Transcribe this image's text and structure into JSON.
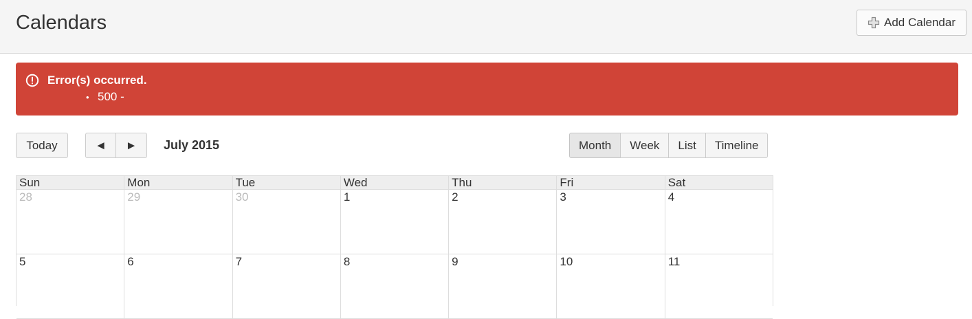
{
  "header": {
    "title": "Calendars",
    "add_button_label": "Add Calendar"
  },
  "alert": {
    "title": "Error(s) occurred.",
    "bullet": "•",
    "items": [
      "500 -"
    ]
  },
  "toolbar": {
    "today_label": "Today",
    "prev_label": "◄",
    "next_label": "►",
    "period_title": "July 2015",
    "views": [
      {
        "label": "Month",
        "active": true
      },
      {
        "label": "Week",
        "active": false
      },
      {
        "label": "List",
        "active": false
      },
      {
        "label": "Timeline",
        "active": false
      }
    ]
  },
  "calendar": {
    "day_names": [
      "Sun",
      "Mon",
      "Tue",
      "Wed",
      "Thu",
      "Fri",
      "Sat"
    ],
    "weeks": [
      [
        {
          "day": "28",
          "other_month": true
        },
        {
          "day": "29",
          "other_month": true
        },
        {
          "day": "30",
          "other_month": true
        },
        {
          "day": "1",
          "other_month": false
        },
        {
          "day": "2",
          "other_month": false
        },
        {
          "day": "3",
          "other_month": false
        },
        {
          "day": "4",
          "other_month": false
        }
      ],
      [
        {
          "day": "5",
          "other_month": false
        },
        {
          "day": "6",
          "other_month": false
        },
        {
          "day": "7",
          "other_month": false
        },
        {
          "day": "8",
          "other_month": false
        },
        {
          "day": "9",
          "other_month": false
        },
        {
          "day": "10",
          "other_month": false
        },
        {
          "day": "11",
          "other_month": false
        }
      ]
    ]
  },
  "colors": {
    "alert_bg": "#d04437",
    "header_bg": "#f5f5f5",
    "other_month_text": "#bbbbbb"
  },
  "icons": {
    "add": "plus-icon",
    "alert": "exclamation-circle-icon"
  }
}
